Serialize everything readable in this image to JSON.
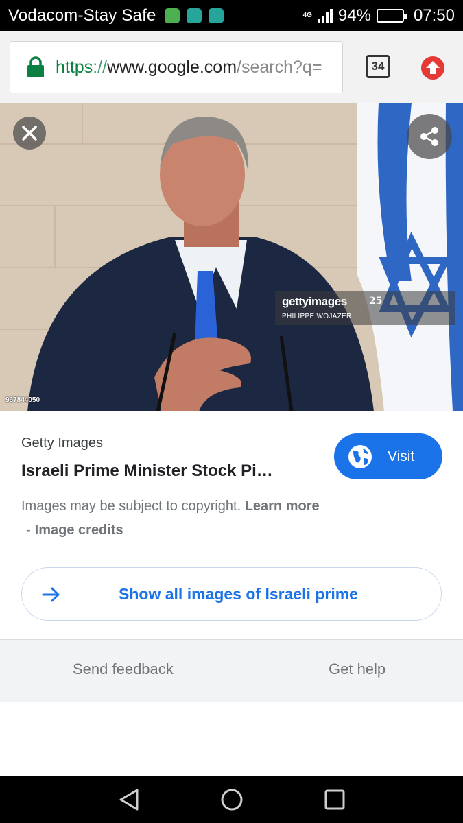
{
  "status_bar": {
    "carrier": "Vodacom-Stay Safe",
    "network": "4G",
    "battery_level": "94%",
    "battery_fraction": 0.94,
    "time": "07:50",
    "notification_icons": [
      "whatsapp-icon",
      "messages-icon",
      "app-icon"
    ]
  },
  "browser": {
    "url_scheme": "https",
    "url_separator": "://",
    "url_host": "www.google.com",
    "url_path": "/search?q=",
    "tab_count": "34"
  },
  "image": {
    "watermark_brand": "gettyimages",
    "watermark_anniversary": "25",
    "photographer": "PHILIPPE WOJAZER",
    "image_id": "967844050"
  },
  "info": {
    "source": "Getty Images",
    "title": "Israeli Prime Minister Stock Pi…",
    "visit_label": "Visit",
    "copyright_text": "Images may be subject to copyright.",
    "learn_more": "Learn more",
    "credits_dash": "-",
    "image_credits": "Image credits",
    "show_all_label": "Show all images of Israeli prime"
  },
  "footer": {
    "send_feedback": "Send feedback",
    "get_help": "Get help"
  },
  "colors": {
    "accent": "#1a73e8",
    "secure_green": "#0b8043",
    "upload_red": "#e53935"
  }
}
